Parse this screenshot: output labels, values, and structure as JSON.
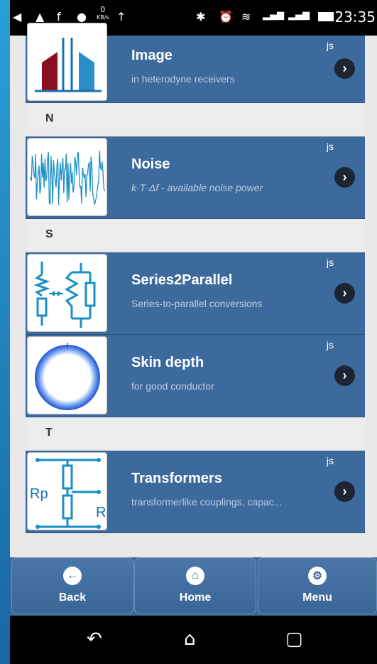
{
  "status_bar": {
    "kbs_value": "0",
    "kbs_unit": "KB/s",
    "time": "23:35"
  },
  "list": {
    "items": [
      {
        "title": "Image",
        "subtitle": "in heterodyne receivers",
        "tag": "js",
        "icon": "image-frequency-icon"
      },
      {
        "title": "Noise",
        "subtitle": "k·T·Δf - available noise power",
        "tag": "js",
        "icon": "noise-waveform-icon"
      },
      {
        "title": "Series2Parallel",
        "subtitle": "Series-to-parallel conversions",
        "tag": "js",
        "icon": "series-parallel-circuit-icon"
      },
      {
        "title": "Skin depth",
        "subtitle": "for good conductor",
        "tag": "js",
        "icon": "skin-depth-ring-icon"
      },
      {
        "title": "Transformers",
        "subtitle": "transformerlike couplings, capac...",
        "tag": "js",
        "icon": "transformer-circuit-icon"
      }
    ],
    "dividers": [
      "N",
      "S",
      "T"
    ]
  },
  "nav": {
    "back_label": "Back",
    "home_label": "Home",
    "menu_label": "Menu"
  },
  "thumb_labels": {
    "rp": "Rp",
    "r": "R"
  },
  "colors": {
    "item_bg": "#3d6a9c",
    "chevron_bg": "#1d2433",
    "subtitle": "#b9cce3"
  }
}
